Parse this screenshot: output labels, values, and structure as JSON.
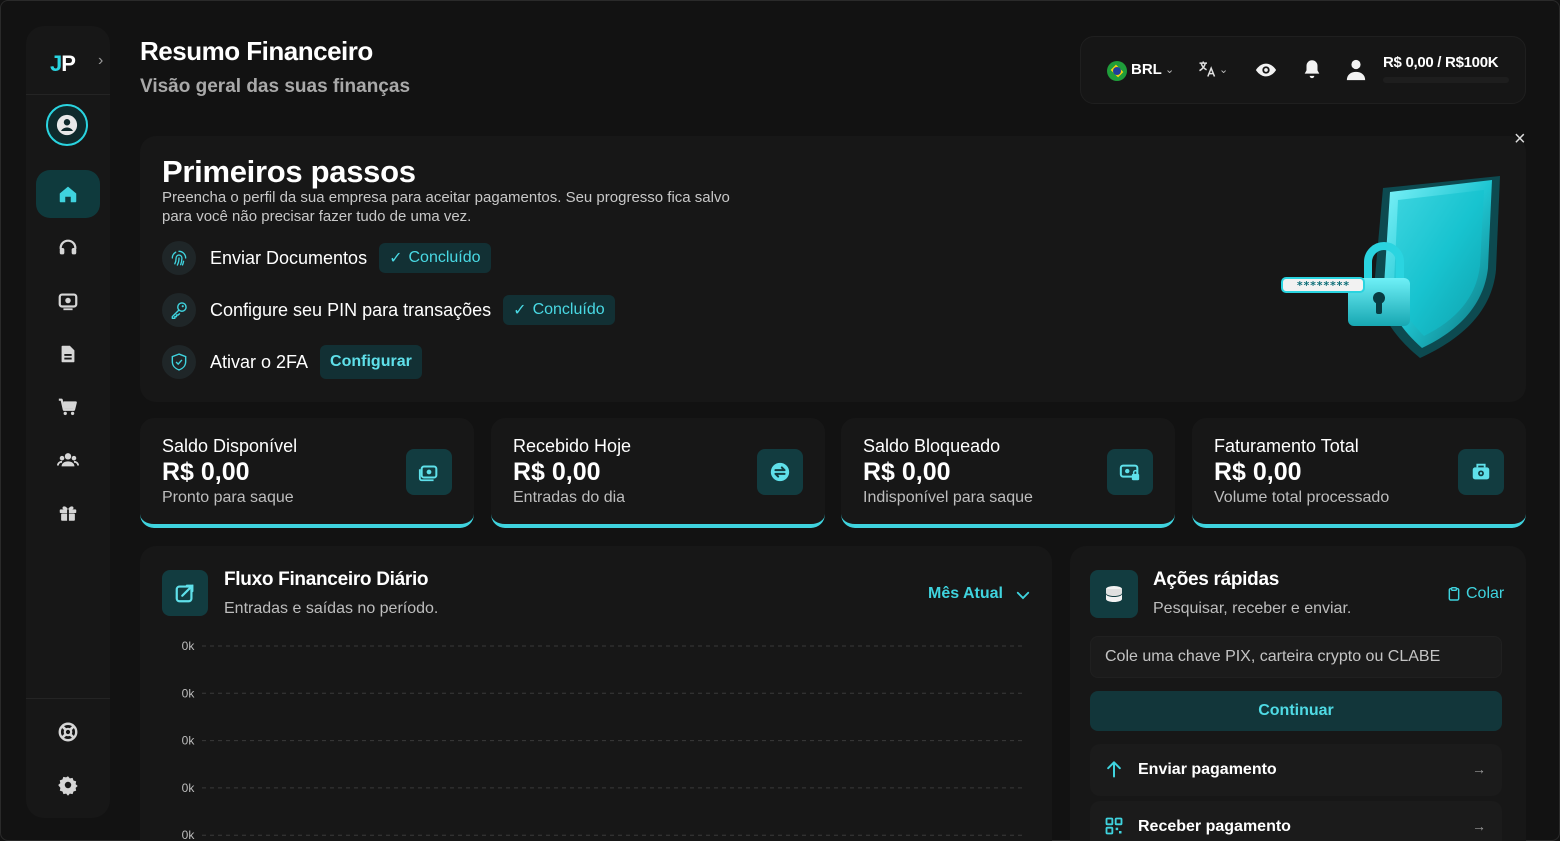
{
  "header": {
    "title": "Resumo Financeiro",
    "subtitle": "Visão geral das suas finanças"
  },
  "sidebar": {
    "logo": "JP",
    "items": [
      {
        "icon": "home-icon",
        "active": true
      },
      {
        "icon": "headset-icon"
      },
      {
        "icon": "money-scan-icon"
      },
      {
        "icon": "document-icon"
      },
      {
        "icon": "cart-icon"
      },
      {
        "icon": "users-icon"
      },
      {
        "icon": "gift-icon"
      }
    ],
    "bottom_items": [
      {
        "icon": "lifebuoy-icon"
      },
      {
        "icon": "gear-icon"
      }
    ]
  },
  "topbar": {
    "currency": "BRL",
    "limit": "R$ 0,00 / R$100K",
    "limit_progress": 0
  },
  "onboarding": {
    "title": "Primeiros passos",
    "description": "Preencha o perfil da sua empresa para aceitar pagamentos. Seu progresso fica salvo para você não precisar fazer tudo de uma vez.",
    "steps": [
      {
        "label": "Enviar Documentos",
        "status": "Concluído",
        "icon": "fingerprint-icon"
      },
      {
        "label": "Configure seu PIN para transações",
        "status": "Concluído",
        "icon": "key-icon"
      },
      {
        "label": "Ativar o 2FA",
        "action": "Configurar",
        "icon": "shield-check-icon"
      }
    ],
    "password_mask": "********",
    "close": "×"
  },
  "stats": [
    {
      "title": "Saldo Disponível",
      "value": "R$ 0,00",
      "sub": "Pronto para saque",
      "icon": "wallet-icon"
    },
    {
      "title": "Recebido Hoje",
      "value": "R$ 0,00",
      "sub": "Entradas do dia",
      "icon": "exchange-icon"
    },
    {
      "title": "Saldo Bloqueado",
      "value": "R$ 0,00",
      "sub": "Indisponível para saque",
      "icon": "locked-money-icon"
    },
    {
      "title": "Faturamento Total",
      "value": "R$ 0,00",
      "sub": "Volume total processado",
      "icon": "safe-icon"
    }
  ],
  "chart_card": {
    "title": "Fluxo Financeiro Diário",
    "subtitle": "Entradas e saídas no período.",
    "period": "Mês Atual"
  },
  "chart_data": {
    "type": "line",
    "title": "Fluxo Financeiro Diário",
    "xlabel": "",
    "ylabel": "",
    "y_tick_labels": [
      "0k",
      "0k",
      "0k",
      "0k",
      "0k"
    ],
    "series": [],
    "grid": true
  },
  "quick_actions": {
    "title": "Ações rápidas",
    "subtitle": "Pesquisar, receber e enviar.",
    "paste_label": "Colar",
    "input_placeholder": "Cole uma chave PIX, carteira crypto ou CLABE",
    "continue_label": "Continuar",
    "rows": [
      {
        "label": "Enviar pagamento",
        "icon": "arrow-up-icon"
      },
      {
        "label": "Receber pagamento",
        "icon": "qr-code-icon"
      }
    ]
  },
  "colors": {
    "accent": "#3fd3de",
    "background": "#121212",
    "card": "#171717"
  }
}
